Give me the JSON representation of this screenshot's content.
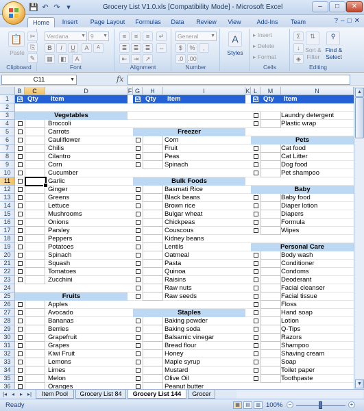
{
  "window": {
    "title": "Grocery List V1.0.xls  [Compatibility Mode] - Microsoft Excel",
    "controls": [
      "–",
      "□",
      "✕"
    ]
  },
  "quick_access": [
    "💾",
    "↶",
    "↷",
    "▾"
  ],
  "ribbon_tabs": [
    "Home",
    "Insert",
    "Page Layout",
    "Formulas",
    "Data",
    "Review",
    "View",
    "Add-Ins",
    "Team"
  ],
  "ribbon": {
    "clipboard": {
      "label": "Clipboard",
      "paste": "Paste"
    },
    "font": {
      "label": "Font",
      "font_name": "Verdana",
      "font_size": "9"
    },
    "alignment": {
      "label": "Alignment"
    },
    "number": {
      "label": "Number",
      "format": "General"
    },
    "styles": {
      "label": "Styles"
    },
    "cells": {
      "label": "Cells",
      "insert": "Insert",
      "delete": "Delete",
      "format": "Format"
    },
    "editing": {
      "label": "Editing",
      "sort": "Sort &",
      "sort2": "Filter",
      "find": "Find &",
      "find2": "Select"
    }
  },
  "formula_bar": {
    "name_box": "C11",
    "fx": "fx",
    "formula": ""
  },
  "columns": [
    {
      "id": "B",
      "selected": false
    },
    {
      "id": "C",
      "selected": true
    },
    {
      "id": "D",
      "selected": false
    },
    {
      "id": "F",
      "selected": false
    },
    {
      "id": "G",
      "selected": false
    },
    {
      "id": "H",
      "selected": false
    },
    {
      "id": "I",
      "selected": false
    },
    {
      "id": "K",
      "selected": false
    },
    {
      "id": "L",
      "selected": false
    },
    {
      "id": "M",
      "selected": false
    },
    {
      "id": "N",
      "selected": false
    }
  ],
  "rows": [
    "1",
    "2",
    "3",
    "4",
    "5",
    "6",
    "7",
    "8",
    "9",
    "10",
    "11",
    "12",
    "13",
    "14",
    "15",
    "16",
    "17",
    "18",
    "19",
    "20",
    "21",
    "22",
    "23",
    "24",
    "25",
    "26",
    "27",
    "28",
    "29",
    "30",
    "31",
    "32",
    "33",
    "34",
    "35",
    "36"
  ],
  "selected_row": "11",
  "header": {
    "check": "☑",
    "qty": "Qty",
    "item": "Item"
  },
  "col1": [
    {
      "row": 3,
      "section": "Vegetables"
    },
    {
      "row": 4,
      "item": "Broccoli"
    },
    {
      "row": 5,
      "item": "Carrots"
    },
    {
      "row": 6,
      "item": "Cauliflower"
    },
    {
      "row": 7,
      "item": "Chilis"
    },
    {
      "row": 8,
      "item": "Cilantro"
    },
    {
      "row": 9,
      "item": "Corn"
    },
    {
      "row": 10,
      "item": "Cucumber"
    },
    {
      "row": 11,
      "item": "Garlic"
    },
    {
      "row": 12,
      "item": "Ginger"
    },
    {
      "row": 13,
      "item": "Greens"
    },
    {
      "row": 14,
      "item": "Lettuce"
    },
    {
      "row": 15,
      "item": "Mushrooms"
    },
    {
      "row": 16,
      "item": "Onions"
    },
    {
      "row": 17,
      "item": "Parsley"
    },
    {
      "row": 18,
      "item": "Peppers"
    },
    {
      "row": 19,
      "item": "Potatoes"
    },
    {
      "row": 20,
      "item": "Spinach"
    },
    {
      "row": 21,
      "item": "Squash"
    },
    {
      "row": 22,
      "item": "Tomatoes"
    },
    {
      "row": 23,
      "item": "Zucchini"
    },
    {
      "row": 25,
      "section": "Fruits"
    },
    {
      "row": 26,
      "item": "Apples"
    },
    {
      "row": 27,
      "item": "Avocado"
    },
    {
      "row": 28,
      "item": "Bananas"
    },
    {
      "row": 29,
      "item": "Berries"
    },
    {
      "row": 30,
      "item": "Grapefruit"
    },
    {
      "row": 31,
      "item": "Grapes"
    },
    {
      "row": 32,
      "item": "Kiwi Fruit"
    },
    {
      "row": 33,
      "item": "Lemons"
    },
    {
      "row": 34,
      "item": "Limes"
    },
    {
      "row": 35,
      "item": "Melon"
    },
    {
      "row": 36,
      "item": "Oranges"
    }
  ],
  "col2": [
    {
      "row": 5,
      "section": "Freezer"
    },
    {
      "row": 6,
      "item": "Corn"
    },
    {
      "row": 7,
      "item": "Fruit"
    },
    {
      "row": 8,
      "item": "Peas"
    },
    {
      "row": 9,
      "item": "Spinach"
    },
    {
      "row": 11,
      "section": "Bulk Foods"
    },
    {
      "row": 12,
      "item": "Basmati Rice"
    },
    {
      "row": 13,
      "item": "Black beans"
    },
    {
      "row": 14,
      "item": "Brown rice"
    },
    {
      "row": 15,
      "item": "Bulgar wheat"
    },
    {
      "row": 16,
      "item": "Chickpeas"
    },
    {
      "row": 17,
      "item": "Couscous"
    },
    {
      "row": 18,
      "item": "Kidney beans"
    },
    {
      "row": 19,
      "item": "Lentils"
    },
    {
      "row": 20,
      "item": "Oatmeal"
    },
    {
      "row": 21,
      "item": "Pasta"
    },
    {
      "row": 22,
      "item": "Quinoa"
    },
    {
      "row": 23,
      "item": "Raisins"
    },
    {
      "row": 24,
      "item": "Raw nuts"
    },
    {
      "row": 25,
      "item": "Raw seeds"
    },
    {
      "row": 27,
      "section": "Staples"
    },
    {
      "row": 28,
      "item": "Baking powder"
    },
    {
      "row": 29,
      "item": "Baking soda"
    },
    {
      "row": 30,
      "item": "Balsamic vinegar"
    },
    {
      "row": 31,
      "item": "Bread flour"
    },
    {
      "row": 32,
      "item": "Honey"
    },
    {
      "row": 33,
      "item": "Maple syrup"
    },
    {
      "row": 34,
      "item": "Mustard"
    },
    {
      "row": 35,
      "item": "Olive Oil"
    },
    {
      "row": 36,
      "item": "Peanut butter"
    }
  ],
  "col3": [
    {
      "row": 3,
      "item": "Laundry detergent"
    },
    {
      "row": 4,
      "item": "Plastic wrap"
    },
    {
      "row": 6,
      "section": "Pets"
    },
    {
      "row": 7,
      "item": "Cat food"
    },
    {
      "row": 8,
      "item": "Cat Litter"
    },
    {
      "row": 9,
      "item": "Dog food"
    },
    {
      "row": 10,
      "item": "Pet shampoo"
    },
    {
      "row": 12,
      "section": "Baby"
    },
    {
      "row": 13,
      "item": "Baby food"
    },
    {
      "row": 14,
      "item": "Diaper lotion"
    },
    {
      "row": 15,
      "item": "Diapers"
    },
    {
      "row": 16,
      "item": "Formula"
    },
    {
      "row": 17,
      "item": "Wipes"
    },
    {
      "row": 19,
      "section": "Personal Care"
    },
    {
      "row": 20,
      "item": "Body wash"
    },
    {
      "row": 21,
      "item": "Conditioner"
    },
    {
      "row": 22,
      "item": "Condoms"
    },
    {
      "row": 23,
      "item": "Deoderant"
    },
    {
      "row": 24,
      "item": "Facial cleanser"
    },
    {
      "row": 25,
      "item": "Facial tissue"
    },
    {
      "row": 26,
      "item": "Floss"
    },
    {
      "row": 27,
      "item": "Hand soap"
    },
    {
      "row": 28,
      "item": "Lotion"
    },
    {
      "row": 29,
      "item": "Q-Tips"
    },
    {
      "row": 30,
      "item": "Razors"
    },
    {
      "row": 31,
      "item": "Shampoo"
    },
    {
      "row": 32,
      "item": "Shaving cream"
    },
    {
      "row": 33,
      "item": "Soap"
    },
    {
      "row": 34,
      "item": "Toilet paper"
    },
    {
      "row": 35,
      "item": "Toothpaste"
    }
  ],
  "sheet_tabs": [
    {
      "label": "Item Pool",
      "active": false
    },
    {
      "label": "Grocery List 84",
      "active": false
    },
    {
      "label": "Grocery List 144",
      "active": true
    },
    {
      "label": "Grocer",
      "active": false
    }
  ],
  "nav_buttons": [
    "|◂",
    "◂",
    "▸",
    "▸|"
  ],
  "status": {
    "text": "Ready",
    "zoom": "100%"
  },
  "colors": {
    "header_blue": "#2561d6",
    "section_blue": "#bcd8f2",
    "selected_header": "#f2c061"
  }
}
